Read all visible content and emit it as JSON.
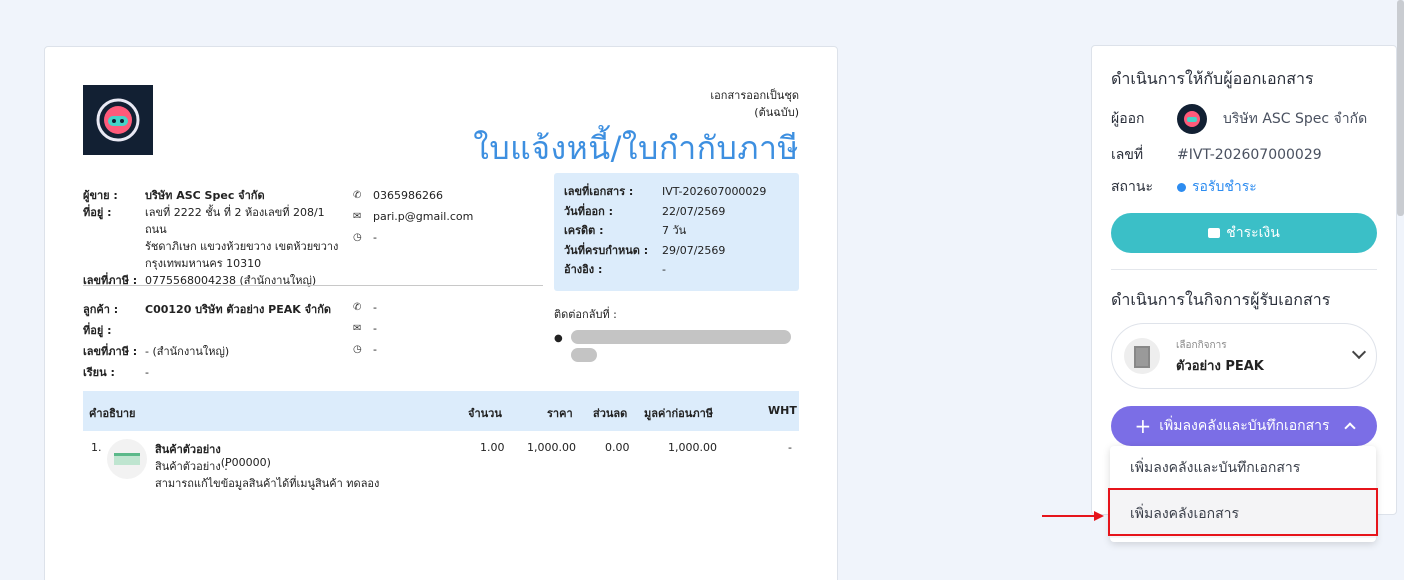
{
  "document": {
    "copy_note": "เอกสารออกเป็นชุด",
    "original_note": "(ต้นฉบับ)",
    "title": "ใบแจ้งหนี้/ใบกำกับภาษี",
    "seller": {
      "label_seller": "ผู้ขาย :",
      "name": "บริษัท ASC Spec จำกัด",
      "label_address": "ที่อยู่ :",
      "address_line1": "เลขที่ 2222 ชั้น ที่ 2 ห้องเลขที่ 208/1 ถนน",
      "address_line2": "รัชดาภิเษก แขวงห้วยขวาง เขตห้วยขวาง",
      "address_line3": "กรุงเทพมหานคร 10310",
      "label_tax": "เลขที่ภาษี :",
      "tax_id": "0775568004238 (สำนักงานใหญ่)",
      "phone": "0365986266",
      "email": "pari.p@gmail.com",
      "web": "-"
    },
    "info": {
      "doc_no_label": "เลขที่เอกสาร :",
      "doc_no": "IVT-202607000029",
      "issue_label": "วันที่ออก :",
      "issue_date": "22/07/2569",
      "credit_label": "เครดิต :",
      "credit": "7 วัน",
      "due_label": "วันที่ครบกำหนด :",
      "due_date": "29/07/2569",
      "ref_label": "อ้างอิง :",
      "ref": "-"
    },
    "customer": {
      "label_customer": "ลูกค้า :",
      "name": "C00120 บริษัท ตัวอย่าง PEAK จำกัด",
      "label_address": "ที่อยู่ :",
      "label_tax": "เลขที่ภาษี :",
      "tax_id": "- (สำนักงานใหญ่)",
      "label_attn": "เรียน :",
      "attn": "-",
      "phone": "-",
      "email": "-",
      "web": "-"
    },
    "contact_back_label": "ติดต่อกลับที่ :",
    "table": {
      "headers": [
        "คำอธิบาย",
        "จำนวน",
        "ราคา",
        "ส่วนลด",
        "มูลค่าก่อนภาษี",
        "WHT"
      ],
      "rows": [
        {
          "no": "1.",
          "name": "สินค้าตัวอย่าง",
          "code": "(P00000)",
          "sub1": "สินค้าตัวอย่าง :",
          "sub2": "สามารถแก้ไขข้อมูลสินค้าได้ที่เมนูสินค้า ทดลอง",
          "qty": "1.00",
          "price": "1,000.00",
          "discount": "0.00",
          "amount": "1,000.00",
          "wht": "-"
        }
      ]
    }
  },
  "panel": {
    "issuer_section_title": "ดำเนินการให้กับผู้ออกเอกสาร",
    "issuer_label": "ผู้ออก",
    "issuer_name": "บริษัท ASC Spec จำกัด",
    "number_label": "เลขที่",
    "number": "#IVT-202607000029",
    "status_label": "สถานะ",
    "status": "รอรับชำระ",
    "pay_button": "ชำระเงิน",
    "receiver_section_title": "ดำเนินการในกิจการผู้รับเอกสาร",
    "business_select_small": "เลือกกิจการ",
    "business_select_value": "ตัวอย่าง PEAK",
    "save_button": "เพิ่มลงคลังและบันทึกเอกสาร",
    "dropdown": [
      "เพิ่มลงคลังและบันทึกเอกสาร",
      "เพิ่มลงคลังเอกสาร"
    ]
  },
  "colors": {
    "title_blue": "#3d8fe0",
    "info_bg": "#dcecfb",
    "pay_teal": "#3bbfc7",
    "save_purple": "#7b6ee6",
    "status_blue": "#2d8cf0",
    "highlight_red": "#e6141b"
  }
}
